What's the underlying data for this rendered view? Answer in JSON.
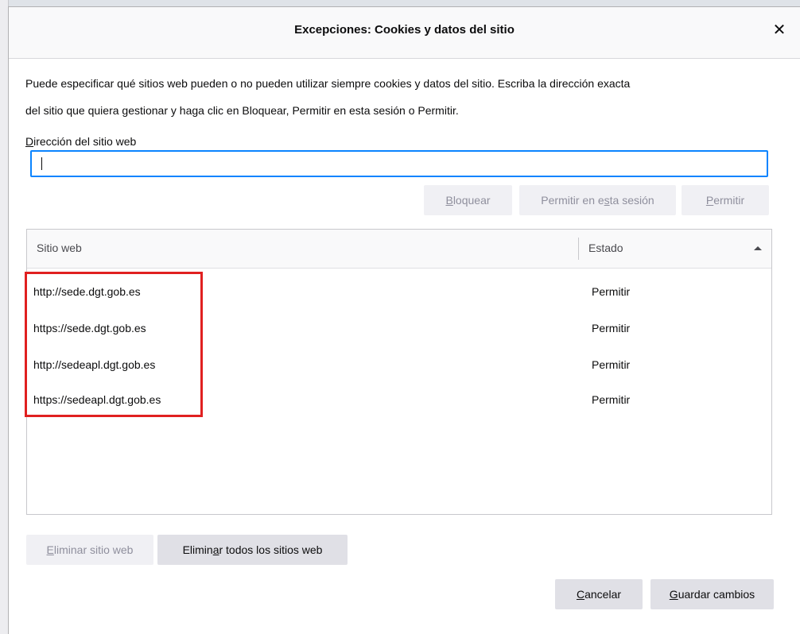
{
  "dialog": {
    "title": "Excepciones: Cookies y datos del sitio",
    "close_glyph": "✕"
  },
  "description": {
    "line1": "Puede especificar qué sitios web pueden o no pueden utilizar siempre cookies y datos del sitio. Escriba la dirección exacta",
    "line2": "del sitio que quiera gestionar y haga clic en Bloquear, Permitir en esta sesión o Permitir."
  },
  "address": {
    "label_accesskey": "D",
    "label_rest": "irección del sitio web",
    "value": "",
    "placeholder": ""
  },
  "actions": {
    "block_key": "B",
    "block_rest": "loquear",
    "session_pre": "Permitir en e",
    "session_key": "s",
    "session_rest": "ta sesión",
    "allow_key": "P",
    "allow_rest": "ermitir"
  },
  "table": {
    "col_site": "Sitio web",
    "col_status": "Estado",
    "rows": [
      {
        "site": "http://sede.dgt.gob.es",
        "status": "Permitir"
      },
      {
        "site": "https://sede.dgt.gob.es",
        "status": "Permitir"
      },
      {
        "site": "http://sedeapl.dgt.gob.es",
        "status": "Permitir"
      },
      {
        "site": "https://sedeapl.dgt.gob.es",
        "status": "Permitir"
      }
    ]
  },
  "bottom": {
    "remove_key": "E",
    "remove_rest": "liminar sitio web",
    "remove_all_pre": "Elimin",
    "remove_all_key": "a",
    "remove_all_rest": "r todos los sitios web",
    "cancel_key": "C",
    "cancel_rest": "ancelar",
    "save_key": "G",
    "save_rest": "uardar cambios"
  },
  "colors": {
    "focus_border": "#0a84ff",
    "highlight": "#e02020"
  }
}
